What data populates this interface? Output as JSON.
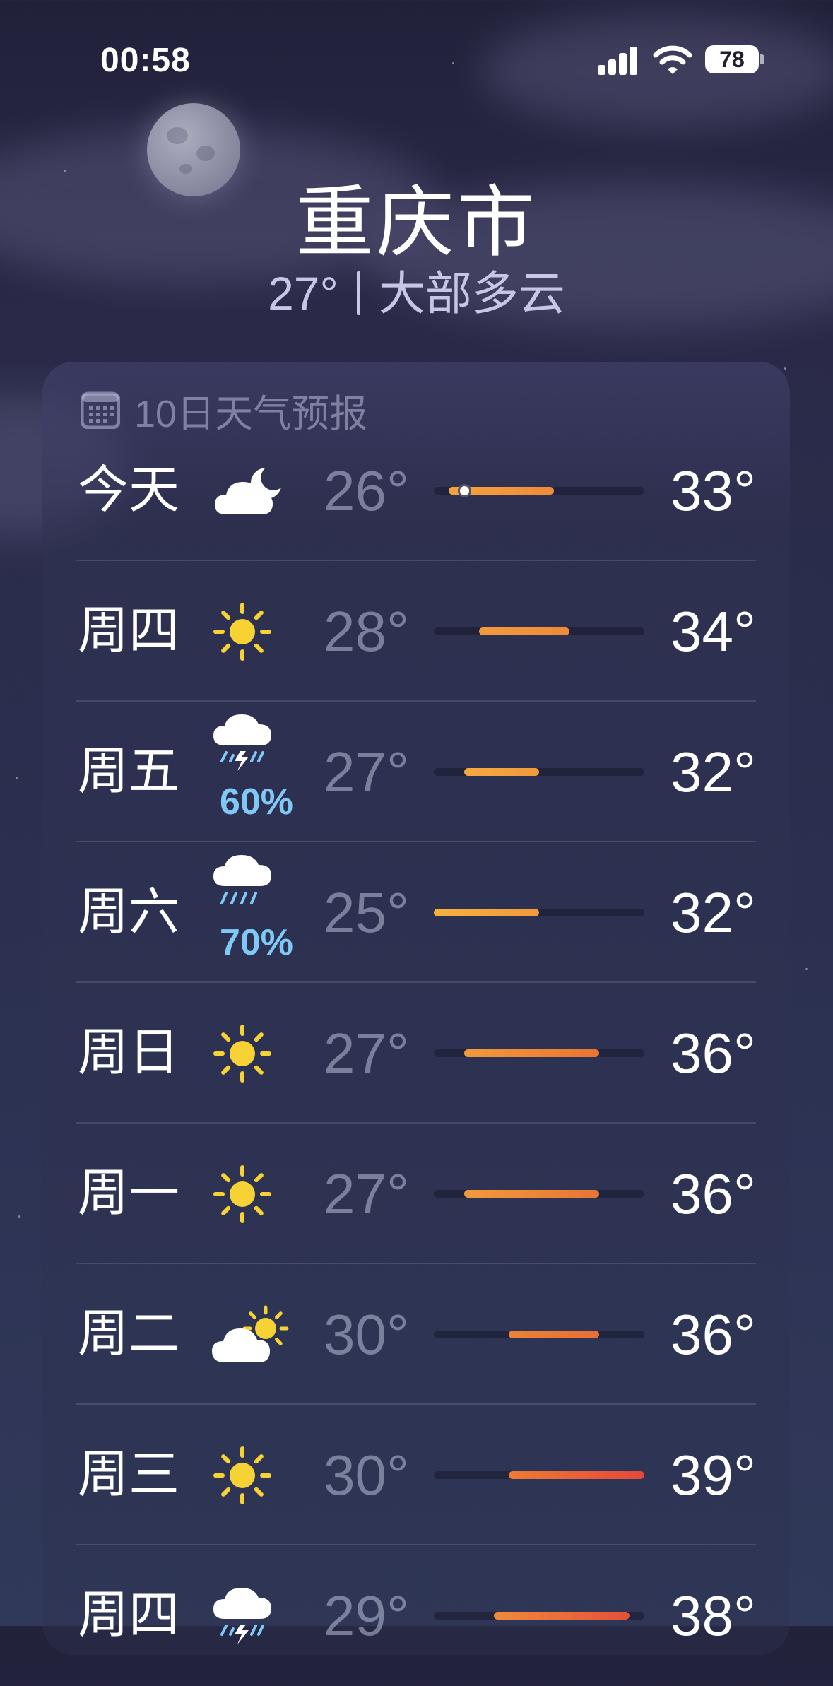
{
  "status_bar": {
    "time": "00:58",
    "battery": "78",
    "signal_icon": "cellular-signal-icon",
    "wifi_icon": "wifi-icon"
  },
  "header": {
    "city": "重庆市",
    "current_temp": "27°",
    "condition": "大部多云"
  },
  "forecast": {
    "title": "10日天气预报",
    "icon": "calendar-icon",
    "range_min": 25,
    "range_max": 39,
    "days": [
      {
        "day": "今天",
        "icon": "cloud-moon",
        "precip": "",
        "low": "26°",
        "high": "33°",
        "low_value": 26,
        "high_value": 33,
        "current_value": 27,
        "colors": [
          "#f4a340",
          "#ef8a3a"
        ]
      },
      {
        "day": "周四",
        "icon": "sun",
        "precip": "",
        "low": "28°",
        "high": "34°",
        "low_value": 28,
        "high_value": 34,
        "colors": [
          "#f19b3c",
          "#ef8a3a"
        ]
      },
      {
        "day": "周五",
        "icon": "cloud-thunder-rain",
        "precip": "60%",
        "low": "27°",
        "high": "32°",
        "low_value": 27,
        "high_value": 32,
        "colors": [
          "#f4a93f",
          "#f19a3c"
        ]
      },
      {
        "day": "周六",
        "icon": "cloud-rain",
        "precip": "70%",
        "low": "25°",
        "high": "32°",
        "low_value": 25,
        "high_value": 32,
        "colors": [
          "#f5b13e",
          "#f19a3c"
        ]
      },
      {
        "day": "周日",
        "icon": "sun",
        "precip": "",
        "low": "27°",
        "high": "36°",
        "low_value": 27,
        "high_value": 36,
        "colors": [
          "#f19a3c",
          "#e97434"
        ]
      },
      {
        "day": "周一",
        "icon": "sun",
        "precip": "",
        "low": "27°",
        "high": "36°",
        "low_value": 27,
        "high_value": 36,
        "colors": [
          "#f19a3c",
          "#e97434"
        ]
      },
      {
        "day": "周二",
        "icon": "sun-cloud",
        "precip": "",
        "low": "30°",
        "high": "36°",
        "low_value": 30,
        "high_value": 36,
        "colors": [
          "#ec8236",
          "#e86f34"
        ]
      },
      {
        "day": "周三",
        "icon": "sun",
        "precip": "",
        "low": "30°",
        "high": "39°",
        "low_value": 30,
        "high_value": 39,
        "colors": [
          "#ec7b36",
          "#e4483a"
        ]
      },
      {
        "day": "周四",
        "icon": "cloud-thunder-rain",
        "precip": "",
        "low": "29°",
        "high": "38°",
        "low_value": 29,
        "high_value": 38,
        "colors": [
          "#ef8a3a",
          "#e4503a"
        ]
      }
    ]
  }
}
